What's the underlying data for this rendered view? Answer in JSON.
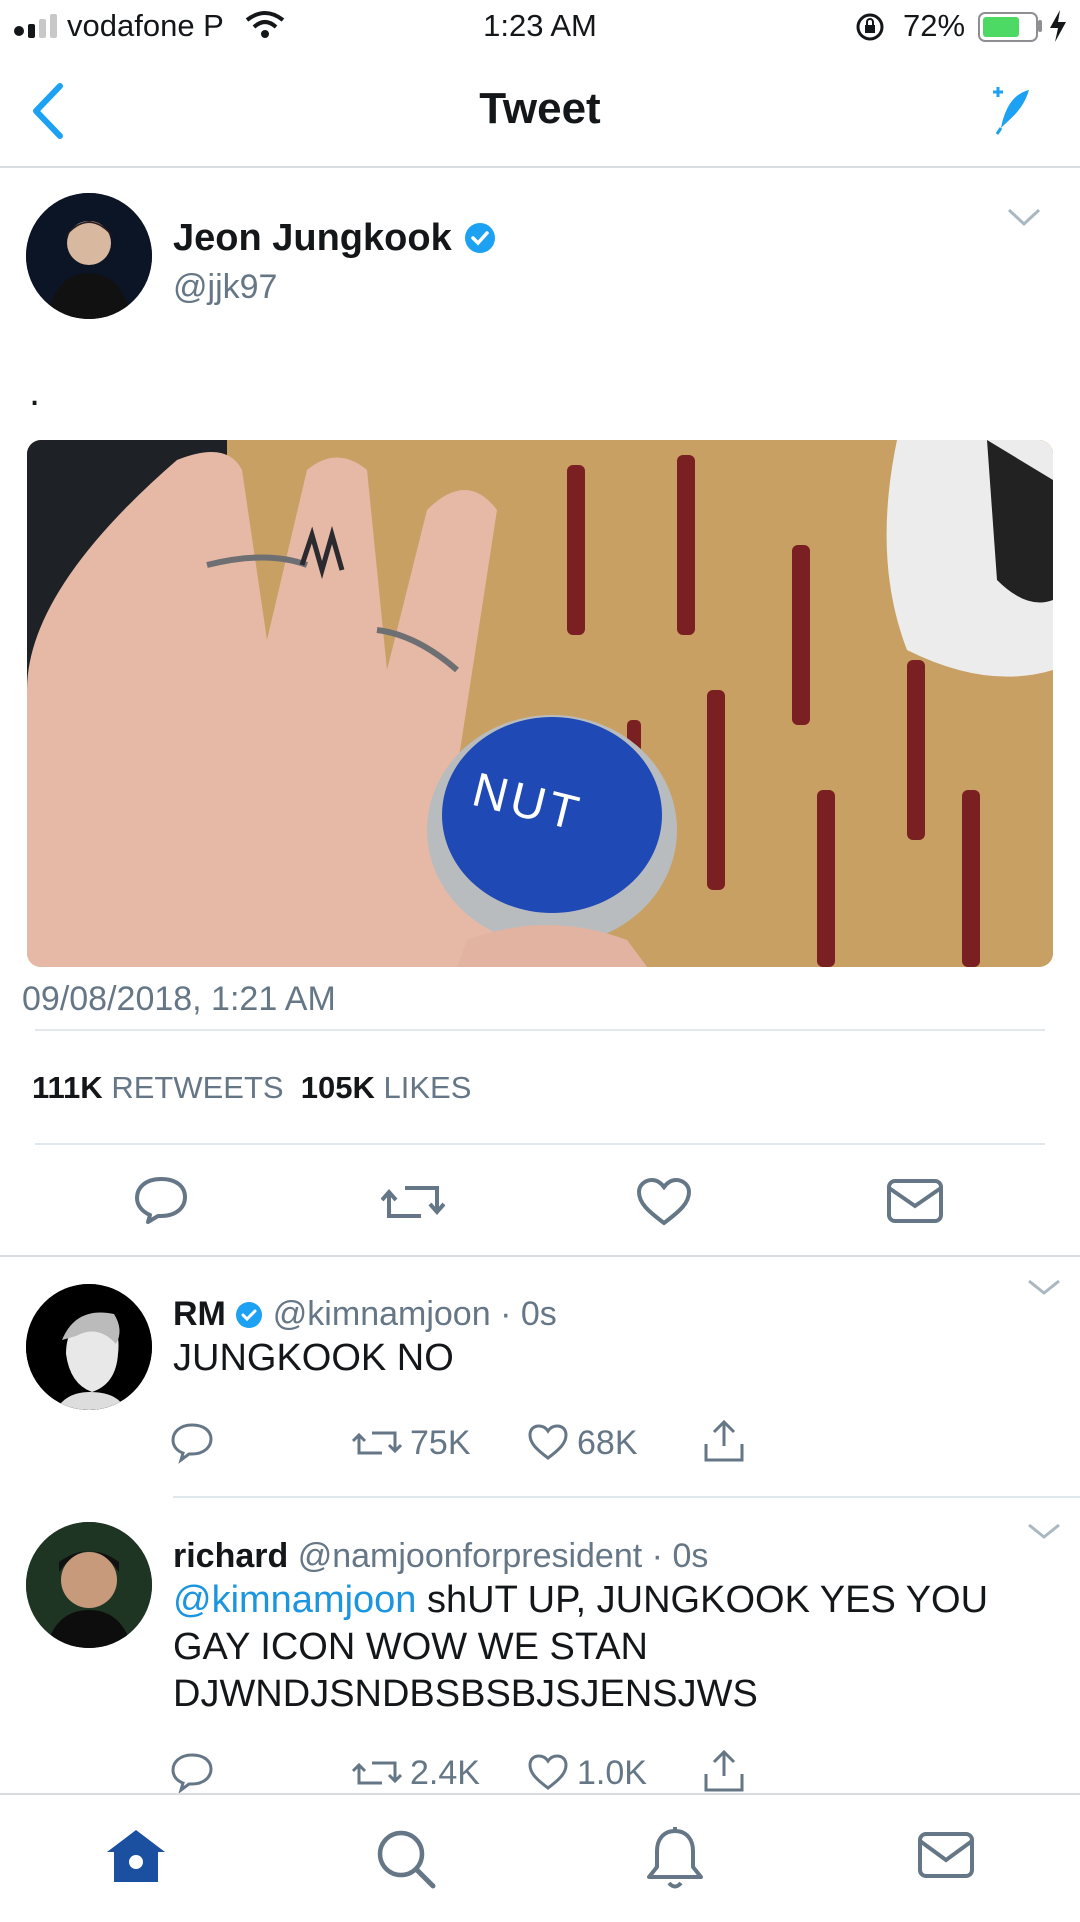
{
  "status_bar": {
    "carrier": "vodafone P",
    "time": "1:23 AM",
    "battery_percent": "72%",
    "battery_level": 0.72
  },
  "header": {
    "title": "Tweet",
    "back_icon": "chevron-left-icon",
    "compose_icon": "compose-feather-icon"
  },
  "tweet": {
    "author_name": "Jeon Jungkook",
    "author_handle": "@jjk97",
    "verified": true,
    "text": ".",
    "image_text": "NUT",
    "timestamp": "09/08/2018, 1:21 AM",
    "retweets_count": "111K",
    "retweets_label": "RETWEETS",
    "likes_count": "105K",
    "likes_label": "LIKES"
  },
  "replies": [
    {
      "name": "RM",
      "verified": true,
      "handle": "@kimnamjoon",
      "time": "0s",
      "text": "JUNGKOOK NO",
      "retweets": "75K",
      "likes": "68K"
    },
    {
      "name": "richard",
      "verified": false,
      "handle": "@namjoonforpresident",
      "time": "0s",
      "mention": "@kimnamjoon",
      "text_line1": " shUT UP, JUNGKOOK YES YOU",
      "text_line2": "GAY ICON WOW WE STAN",
      "text_line3": "DJWNDJSNDBSBSBJSJENSJWS",
      "retweets": "2.4K",
      "likes": "1.0K"
    }
  ],
  "colors": {
    "accent": "#1b95e0",
    "nav_icon": "#1da1f2",
    "tab_active": "#1b4fa0",
    "muted": "#657786",
    "battery": "#4cd964"
  }
}
